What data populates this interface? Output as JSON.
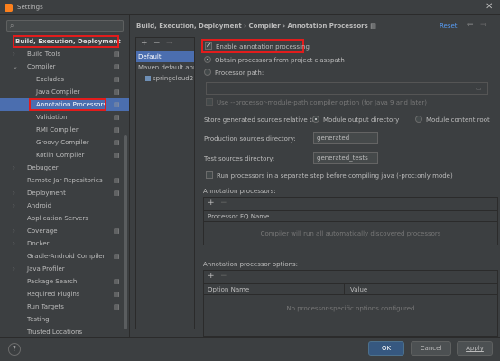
{
  "window": {
    "title": "Settings",
    "close_glyph": "✕"
  },
  "search": {
    "placeholder": "",
    "icon": "search-icon"
  },
  "tree": [
    {
      "label": "Build, Execution, Deployment",
      "indent": 0,
      "arrow": "",
      "cfg": false,
      "bold": true,
      "highlight": true
    },
    {
      "label": "Build Tools",
      "indent": 1,
      "arrow": "›",
      "cfg": true
    },
    {
      "label": "Compiler",
      "indent": 1,
      "arrow": "⌄",
      "cfg": true
    },
    {
      "label": "Excludes",
      "indent": 2,
      "arrow": "",
      "cfg": true
    },
    {
      "label": "Java Compiler",
      "indent": 2,
      "arrow": "",
      "cfg": true
    },
    {
      "label": "Annotation Processors",
      "indent": 2,
      "arrow": "",
      "cfg": true,
      "selected": true,
      "highlight": true
    },
    {
      "label": "Validation",
      "indent": 2,
      "arrow": "",
      "cfg": true
    },
    {
      "label": "RMI Compiler",
      "indent": 2,
      "arrow": "",
      "cfg": true
    },
    {
      "label": "Groovy Compiler",
      "indent": 2,
      "arrow": "",
      "cfg": true
    },
    {
      "label": "Kotlin Compiler",
      "indent": 2,
      "arrow": "",
      "cfg": true
    },
    {
      "label": "Debugger",
      "indent": 1,
      "arrow": "›",
      "cfg": false
    },
    {
      "label": "Remote Jar Repositories",
      "indent": 1,
      "arrow": "",
      "cfg": true
    },
    {
      "label": "Deployment",
      "indent": 1,
      "arrow": "›",
      "cfg": true
    },
    {
      "label": "Android",
      "indent": 1,
      "arrow": "›",
      "cfg": false
    },
    {
      "label": "Application Servers",
      "indent": 1,
      "arrow": "",
      "cfg": false
    },
    {
      "label": "Coverage",
      "indent": 1,
      "arrow": "›",
      "cfg": true
    },
    {
      "label": "Docker",
      "indent": 1,
      "arrow": "›",
      "cfg": false
    },
    {
      "label": "Gradle-Android Compiler",
      "indent": 1,
      "arrow": "",
      "cfg": true
    },
    {
      "label": "Java Profiler",
      "indent": 1,
      "arrow": "›",
      "cfg": false
    },
    {
      "label": "Package Search",
      "indent": 1,
      "arrow": "",
      "cfg": true
    },
    {
      "label": "Required Plugins",
      "indent": 1,
      "arrow": "",
      "cfg": true
    },
    {
      "label": "Run Targets",
      "indent": 1,
      "arrow": "",
      "cfg": true
    },
    {
      "label": "Testing",
      "indent": 1,
      "arrow": "",
      "cfg": false
    },
    {
      "label": "Trusted Locations",
      "indent": 1,
      "arrow": "",
      "cfg": false
    }
  ],
  "header": {
    "breadcrumb": "Build, Execution, Deployment  ›  Compiler  ›  Annotation Processors  ▤",
    "reset": "Reset",
    "back": "←",
    "forward": "→"
  },
  "profiles": {
    "add": "+",
    "remove": "−",
    "move": "→",
    "items": [
      "Default",
      "Maven default annc",
      "springcloud2"
    ]
  },
  "main": {
    "enable_label": "Enable annotation processing",
    "obtain_label": "Obtain processors from project classpath",
    "processor_path_label": "Processor path:",
    "processor_path_value": "",
    "module_path_label": "Use --processor-module-path compiler option (for Java 9 and later)",
    "store_label": "Store generated sources relative to:",
    "module_output_label": "Module output directory",
    "module_content_label": "Module content root",
    "prod_dir_label": "Production sources directory:",
    "prod_dir_value": "generated",
    "test_dir_label": "Test sources directory:",
    "test_dir_value": "generated_tests",
    "separate_step_label": "Run processors in a separate step before compiling java (-proc:only mode)",
    "ap_section": "Annotation processors:",
    "ap_add": "+",
    "ap_remove": "−",
    "ap_col": "Processor FQ Name",
    "ap_empty": "Compiler will run all automatically discovered processors",
    "opt_section": "Annotation processor options:",
    "opt_add": "+",
    "opt_remove": "−",
    "opt_col1": "Option Name",
    "opt_col2": "Value",
    "opt_empty": "No processor-specific options configured"
  },
  "footer": {
    "help": "?",
    "ok": "OK",
    "cancel": "Cancel",
    "apply": "Apply"
  },
  "colors": {
    "accent": "#4b6eaf",
    "link": "#589df6",
    "highlight_border": "#e21c1c"
  }
}
